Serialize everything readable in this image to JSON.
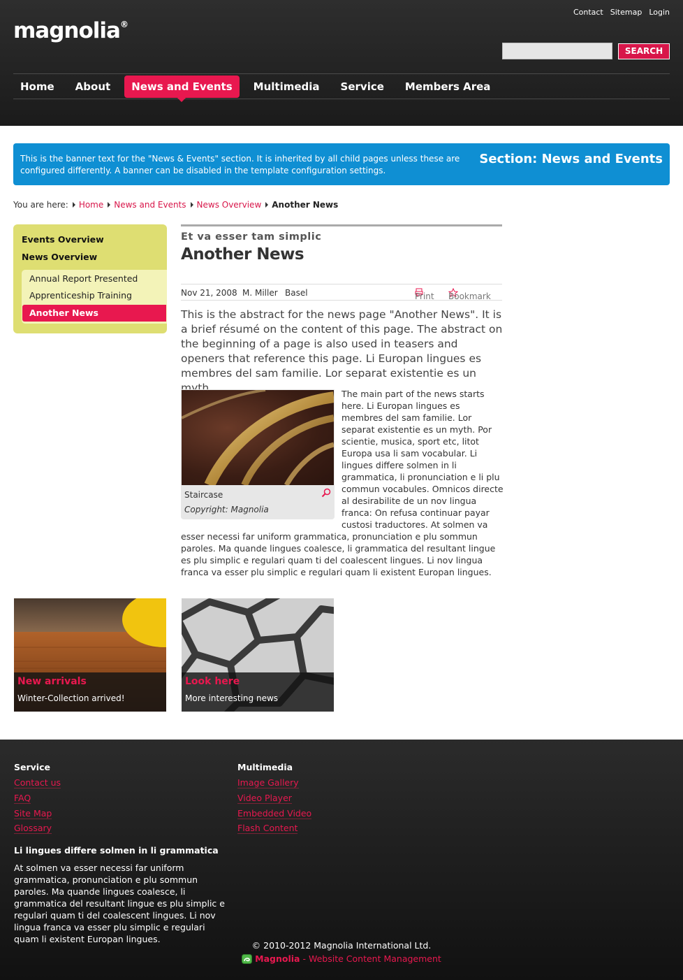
{
  "header": {
    "logo": "magnolia",
    "logo_reg": "®",
    "top_links": [
      "Contact",
      "Sitemap",
      "Login"
    ],
    "search": {
      "placeholder": "",
      "button": "SEARCH"
    },
    "nav": [
      "Home",
      "About",
      "News and Events",
      "Multimedia",
      "Service",
      "Members Area"
    ],
    "nav_active": "News and Events"
  },
  "banner": {
    "text": "This is the banner text for the \"News & Events\" section. It is inherited by all child pages unless these are configured differently. A banner can be disabled in the template configuration settings.",
    "title": "Section: News and Events"
  },
  "breadcrumb": {
    "label": "You are here:",
    "items": [
      "Home",
      "News and Events",
      "News Overview"
    ],
    "current": "Another News"
  },
  "sidebar": {
    "items": [
      "Events Overview",
      "News Overview"
    ],
    "sub_items": [
      "Annual Report Presented",
      "Apprenticeship Training"
    ],
    "active": "Another News"
  },
  "article": {
    "kicker": "Et va esser tam simplic",
    "title": "Another News",
    "date": "Nov 21, 2008",
    "author": "M. Miller",
    "location": "Basel",
    "print": "Print",
    "bookmark": "Bookmark",
    "abstract": "This is the abstract for the news page \"Another News\". It is a brief résumé on the content of this page. The abstract on the beginning of a page is also used in teasers and openers that reference this page. Li Europan lingues es membres del sam familie. Lor separat existentie es un myth.",
    "image_caption": "Staircase",
    "image_copyright": "Copyright: Magnolia",
    "body": "The main part of the news starts here. Li Europan lingues es membres del sam familie. Lor separat existentie es un myth. Por scientie, musica, sport etc, litot Europa usa li sam vocabular. Li lingues differe solmen in li grammatica, li pronunciation e li plu commun vocabules. Omnicos directe al desirabilite de un nov lingua franca: On refusa continuar payar custosi traductores. At solmen va esser necessi far uniform grammatica, pronunciation e plu sommun paroles. Ma quande lingues coalesce, li grammatica del resultant lingue es plu simplic e regulari quam ti del coalescent lingues. Li nov lingua franca va esser plu simplic e regulari quam li existent Europan lingues."
  },
  "teasers": [
    {
      "title": "New arrivals",
      "subtitle": "Winter-Collection arrived!"
    },
    {
      "title": "Look here",
      "subtitle": "More interesting news"
    }
  ],
  "footer": {
    "col1_head": "Service",
    "col1_links": [
      "Contact us",
      "FAQ",
      "Site Map",
      "Glossary"
    ],
    "col2_head": "Multimedia",
    "col2_links": [
      "Image Gallery",
      "Video Player",
      "Embedded Video",
      "Flash Content"
    ],
    "text_head": "Li lingues differe solmen in li grammatica",
    "text": "At solmen va esser necessi far uniform grammatica, pronunciation e plu sommun paroles. Ma quande lingues coalesce, li grammatica del resultant lingue es plu simplic e regulari quam ti del coalescent lingues. Li nov lingua franca va esser plu simplic e regulari quam li existent Europan lingues.",
    "copyright": "© 2010-2012 Magnolia International Ltd.",
    "powered_brand": "Magnolia",
    "powered_text": " - Website Content Management"
  },
  "colors": {
    "accent": "#e8184f",
    "banner": "#0f8fd3",
    "sidebar": "#dede72",
    "header": "#222222"
  }
}
